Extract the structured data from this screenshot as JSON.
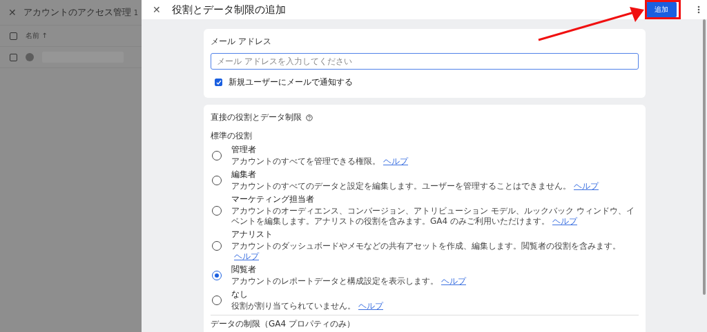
{
  "background_page": {
    "close": "✕",
    "title": "アカウントのアクセス管理",
    "count": "1",
    "column_header": "名前 ↑",
    "rows": [
      {
        "checked": false
      }
    ],
    "header_checked": false
  },
  "dialog": {
    "close": "✕",
    "title": "役割とデータ制限の追加",
    "add_button": "追加"
  },
  "email_card": {
    "title": "メール アドレス",
    "placeholder": "メール アドレスを入力してください",
    "notify": {
      "label": "新規ユーザーにメールで通知する",
      "checked": true
    }
  },
  "roles_card": {
    "title": "直接の役割とデータ制限",
    "section": "標準の役割",
    "roles": [
      {
        "name": "管理者",
        "description": "アカウントのすべてを管理できる権限。",
        "help": "ヘルプ",
        "selected": false
      },
      {
        "name": "編集者",
        "description": "アカウントのすべてのデータと設定を編集します。ユーザーを管理することはできません。",
        "help": "ヘルプ",
        "selected": false
      },
      {
        "name": "マーケティング担当者",
        "description": "アカウントのオーディエンス、コンバージョン、アトリビューション モデル、ルックバック ウィンドウ、イベントを編集します。アナリストの役割を含みます。GA4 のみご利用いただけます。",
        "help": "ヘルプ",
        "selected": false
      },
      {
        "name": "アナリスト",
        "description": "アカウントのダッシュボードやメモなどの共有アセットを作成、編集します。閲覧者の役割を含みます。",
        "help": "ヘルプ",
        "selected": false
      },
      {
        "name": "閲覧者",
        "description": "アカウントのレポートデータと構成設定を表示します。",
        "help": "ヘルプ",
        "selected": true
      },
      {
        "name": "なし",
        "description": "役割が割り当てられていません。",
        "help": "ヘルプ",
        "selected": false
      }
    ],
    "restrictions_title": "データの制限（GA4 プロパティのみ）"
  }
}
